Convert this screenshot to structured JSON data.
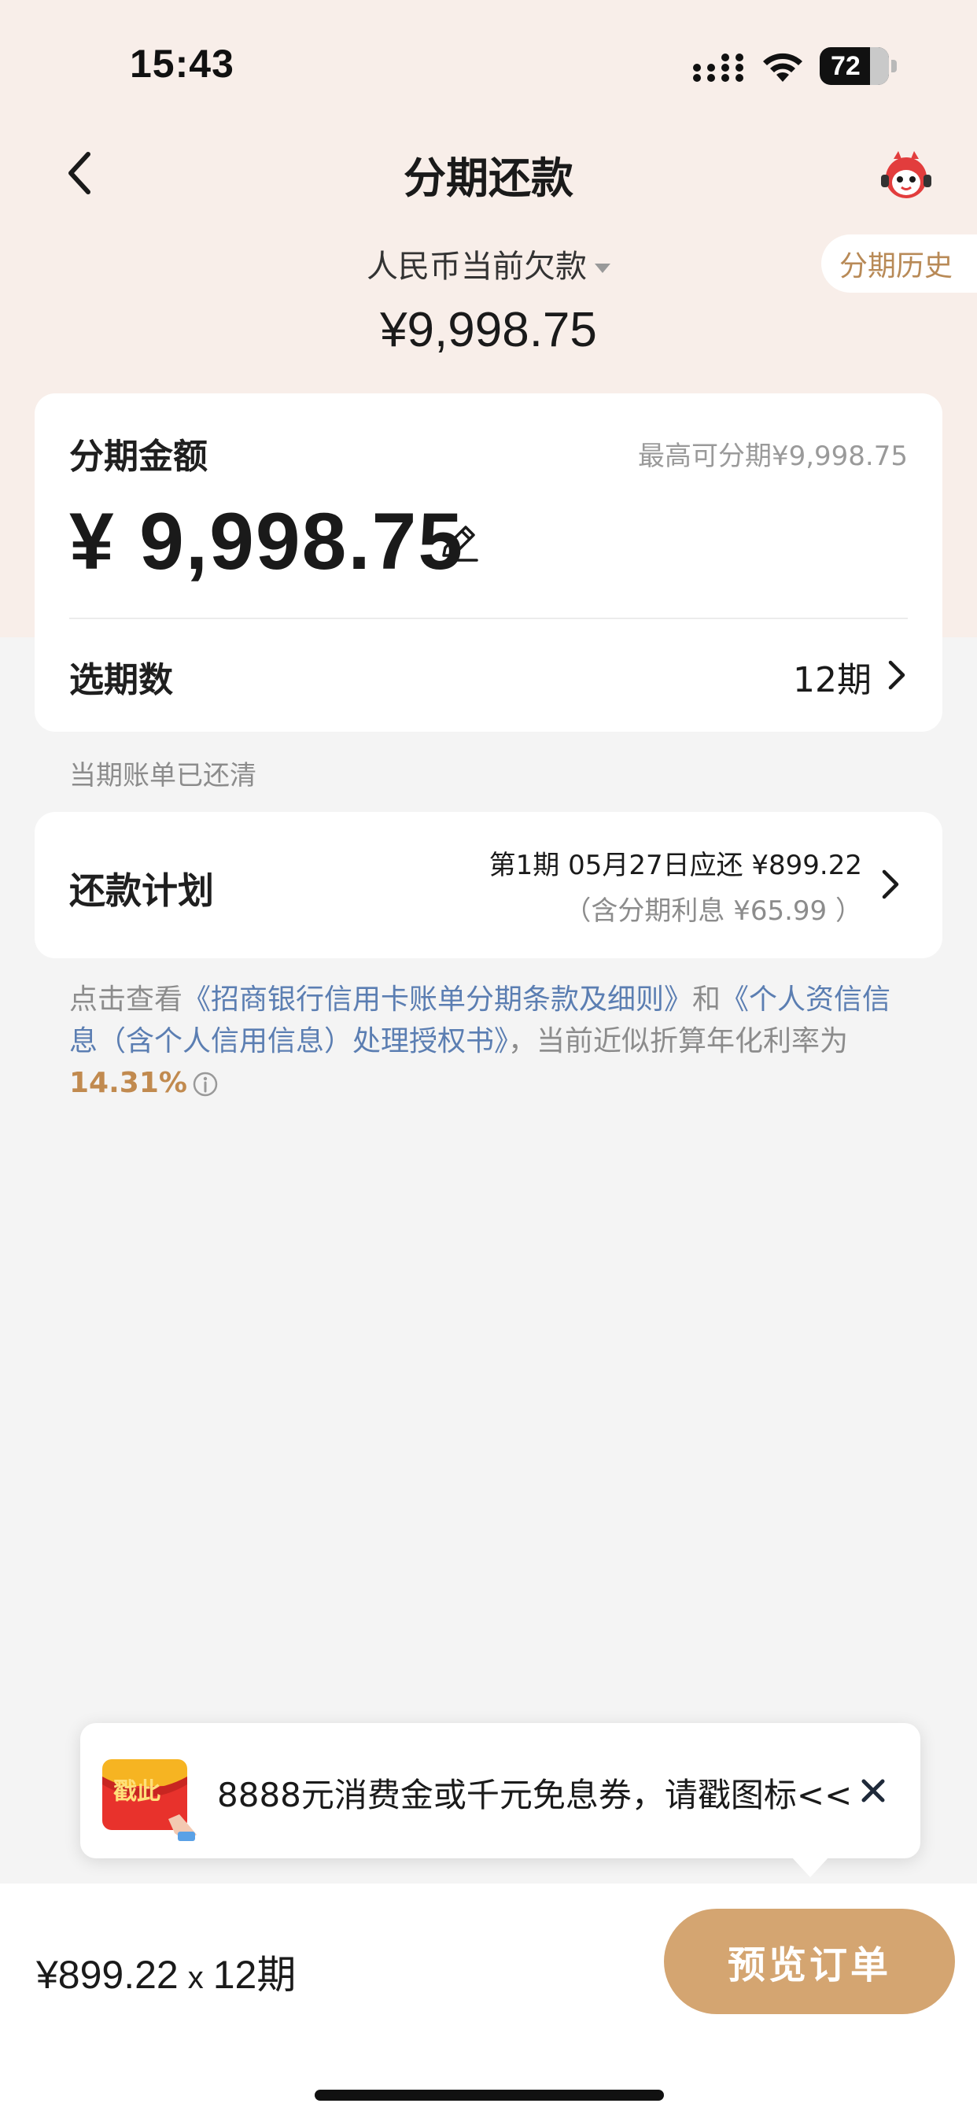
{
  "status_bar": {
    "time": "15:43",
    "battery": "72"
  },
  "nav": {
    "title": "分期还款",
    "back_icon": "chevron-left-icon",
    "service_icon": "mascot-service-icon"
  },
  "summary": {
    "label": "人民币当前欠款",
    "amount": "¥9,998.75",
    "history_button": "分期历史"
  },
  "installment_card": {
    "label": "分期金额",
    "max_text": "最高可分期¥9,998.75",
    "amount": "¥ 9,998.75",
    "period_label": "选期数",
    "period_value": "12期"
  },
  "bill_note": "当期账单已还清",
  "plan_card": {
    "label": "还款计划",
    "line1": "第1期 05月27日应还 ¥899.22",
    "line2": "（含分期利息 ¥65.99 ）"
  },
  "terms": {
    "prefix": "点击查看",
    "link1": "《招商银行信用卡账单分期条款及细则》",
    "and": "和",
    "link2": "《个人资信信息（含个人信用信息）处理授权书》",
    "middle": "，当前近似折算年化利率为",
    "rate": "14.31%"
  },
  "promo": {
    "badge": "戳此",
    "text": "8888元消费金或千元免息券，请戳图标<<"
  },
  "bottom": {
    "price": "¥899.22",
    "times": "x",
    "periods": "12期",
    "button": "预览订单"
  },
  "colors": {
    "header_bg": "#f8eee9",
    "accent_gold": "#d4a571",
    "link_blue": "#5b7eb2",
    "rate_color": "#c18a4f"
  }
}
